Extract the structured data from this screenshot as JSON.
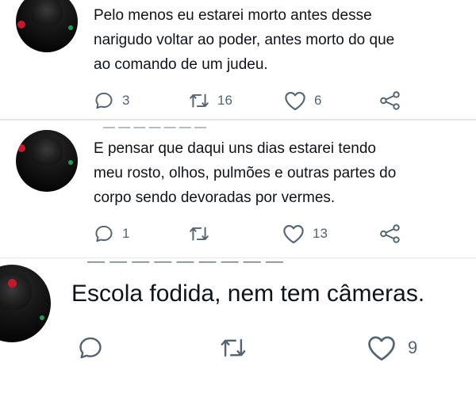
{
  "tweets": [
    {
      "text": "Pelo menos eu estarei morto antes desse\nnarigudo voltar ao poder, antes morto do que\nao comando de um judeu.",
      "replies": "3",
      "retweets": "16",
      "likes": "6"
    },
    {
      "text": "E pensar que daqui uns dias estarei tendo\nmeu rosto, olhos, pulmões e outras partes do\ncorpo sendo devoradas por vermes.",
      "replies": "1",
      "retweets": "",
      "likes": "13"
    },
    {
      "text": "Escola fodida, nem tem câmeras.",
      "replies": "",
      "retweets": "",
      "likes": "9"
    }
  ],
  "icons": {
    "reply": "reply-icon",
    "retweet": "retweet-icon",
    "like": "heart-icon",
    "share": "share-icon"
  },
  "colors": {
    "text": "#0f1419",
    "muted": "#536471",
    "divider": "#e1e4e6"
  }
}
